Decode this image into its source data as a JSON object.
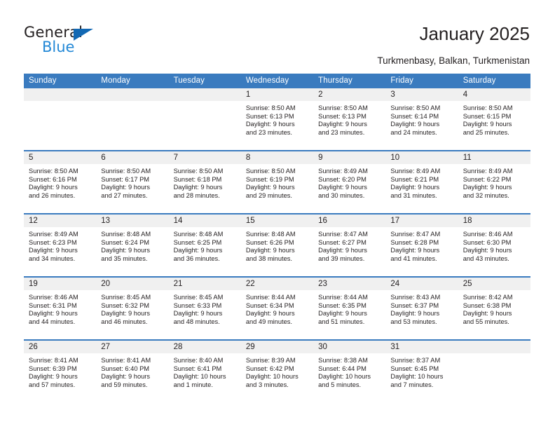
{
  "branding": {
    "logo_primary": "General",
    "logo_secondary": "Blue",
    "logo_icon": "triangle-flag-icon",
    "accent_color": "#3a7bbf",
    "logo_blue": "#2388d6"
  },
  "header": {
    "title": "January 2025",
    "subtitle": "Turkmenbasy, Balkan, Turkmenistan"
  },
  "calendar": {
    "weekday_headers": [
      "Sunday",
      "Monday",
      "Tuesday",
      "Wednesday",
      "Thursday",
      "Friday",
      "Saturday"
    ],
    "labels": {
      "sunrise": "Sunrise:",
      "sunset": "Sunset:",
      "daylight": "Daylight:"
    },
    "weeks": [
      [
        {
          "day": "",
          "empty": true
        },
        {
          "day": "",
          "empty": true
        },
        {
          "day": "",
          "empty": true
        },
        {
          "day": "1",
          "sunrise": "Sunrise: 8:50 AM",
          "sunset": "Sunset: 6:13 PM",
          "daylight1": "Daylight: 9 hours",
          "daylight2": "and 23 minutes."
        },
        {
          "day": "2",
          "sunrise": "Sunrise: 8:50 AM",
          "sunset": "Sunset: 6:13 PM",
          "daylight1": "Daylight: 9 hours",
          "daylight2": "and 23 minutes."
        },
        {
          "day": "3",
          "sunrise": "Sunrise: 8:50 AM",
          "sunset": "Sunset: 6:14 PM",
          "daylight1": "Daylight: 9 hours",
          "daylight2": "and 24 minutes."
        },
        {
          "day": "4",
          "sunrise": "Sunrise: 8:50 AM",
          "sunset": "Sunset: 6:15 PM",
          "daylight1": "Daylight: 9 hours",
          "daylight2": "and 25 minutes."
        }
      ],
      [
        {
          "day": "5",
          "sunrise": "Sunrise: 8:50 AM",
          "sunset": "Sunset: 6:16 PM",
          "daylight1": "Daylight: 9 hours",
          "daylight2": "and 26 minutes."
        },
        {
          "day": "6",
          "sunrise": "Sunrise: 8:50 AM",
          "sunset": "Sunset: 6:17 PM",
          "daylight1": "Daylight: 9 hours",
          "daylight2": "and 27 minutes."
        },
        {
          "day": "7",
          "sunrise": "Sunrise: 8:50 AM",
          "sunset": "Sunset: 6:18 PM",
          "daylight1": "Daylight: 9 hours",
          "daylight2": "and 28 minutes."
        },
        {
          "day": "8",
          "sunrise": "Sunrise: 8:50 AM",
          "sunset": "Sunset: 6:19 PM",
          "daylight1": "Daylight: 9 hours",
          "daylight2": "and 29 minutes."
        },
        {
          "day": "9",
          "sunrise": "Sunrise: 8:49 AM",
          "sunset": "Sunset: 6:20 PM",
          "daylight1": "Daylight: 9 hours",
          "daylight2": "and 30 minutes."
        },
        {
          "day": "10",
          "sunrise": "Sunrise: 8:49 AM",
          "sunset": "Sunset: 6:21 PM",
          "daylight1": "Daylight: 9 hours",
          "daylight2": "and 31 minutes."
        },
        {
          "day": "11",
          "sunrise": "Sunrise: 8:49 AM",
          "sunset": "Sunset: 6:22 PM",
          "daylight1": "Daylight: 9 hours",
          "daylight2": "and 32 minutes."
        }
      ],
      [
        {
          "day": "12",
          "sunrise": "Sunrise: 8:49 AM",
          "sunset": "Sunset: 6:23 PM",
          "daylight1": "Daylight: 9 hours",
          "daylight2": "and 34 minutes."
        },
        {
          "day": "13",
          "sunrise": "Sunrise: 8:48 AM",
          "sunset": "Sunset: 6:24 PM",
          "daylight1": "Daylight: 9 hours",
          "daylight2": "and 35 minutes."
        },
        {
          "day": "14",
          "sunrise": "Sunrise: 8:48 AM",
          "sunset": "Sunset: 6:25 PM",
          "daylight1": "Daylight: 9 hours",
          "daylight2": "and 36 minutes."
        },
        {
          "day": "15",
          "sunrise": "Sunrise: 8:48 AM",
          "sunset": "Sunset: 6:26 PM",
          "daylight1": "Daylight: 9 hours",
          "daylight2": "and 38 minutes."
        },
        {
          "day": "16",
          "sunrise": "Sunrise: 8:47 AM",
          "sunset": "Sunset: 6:27 PM",
          "daylight1": "Daylight: 9 hours",
          "daylight2": "and 39 minutes."
        },
        {
          "day": "17",
          "sunrise": "Sunrise: 8:47 AM",
          "sunset": "Sunset: 6:28 PM",
          "daylight1": "Daylight: 9 hours",
          "daylight2": "and 41 minutes."
        },
        {
          "day": "18",
          "sunrise": "Sunrise: 8:46 AM",
          "sunset": "Sunset: 6:30 PM",
          "daylight1": "Daylight: 9 hours",
          "daylight2": "and 43 minutes."
        }
      ],
      [
        {
          "day": "19",
          "sunrise": "Sunrise: 8:46 AM",
          "sunset": "Sunset: 6:31 PM",
          "daylight1": "Daylight: 9 hours",
          "daylight2": "and 44 minutes."
        },
        {
          "day": "20",
          "sunrise": "Sunrise: 8:45 AM",
          "sunset": "Sunset: 6:32 PM",
          "daylight1": "Daylight: 9 hours",
          "daylight2": "and 46 minutes."
        },
        {
          "day": "21",
          "sunrise": "Sunrise: 8:45 AM",
          "sunset": "Sunset: 6:33 PM",
          "daylight1": "Daylight: 9 hours",
          "daylight2": "and 48 minutes."
        },
        {
          "day": "22",
          "sunrise": "Sunrise: 8:44 AM",
          "sunset": "Sunset: 6:34 PM",
          "daylight1": "Daylight: 9 hours",
          "daylight2": "and 49 minutes."
        },
        {
          "day": "23",
          "sunrise": "Sunrise: 8:44 AM",
          "sunset": "Sunset: 6:35 PM",
          "daylight1": "Daylight: 9 hours",
          "daylight2": "and 51 minutes."
        },
        {
          "day": "24",
          "sunrise": "Sunrise: 8:43 AM",
          "sunset": "Sunset: 6:37 PM",
          "daylight1": "Daylight: 9 hours",
          "daylight2": "and 53 minutes."
        },
        {
          "day": "25",
          "sunrise": "Sunrise: 8:42 AM",
          "sunset": "Sunset: 6:38 PM",
          "daylight1": "Daylight: 9 hours",
          "daylight2": "and 55 minutes."
        }
      ],
      [
        {
          "day": "26",
          "sunrise": "Sunrise: 8:41 AM",
          "sunset": "Sunset: 6:39 PM",
          "daylight1": "Daylight: 9 hours",
          "daylight2": "and 57 minutes."
        },
        {
          "day": "27",
          "sunrise": "Sunrise: 8:41 AM",
          "sunset": "Sunset: 6:40 PM",
          "daylight1": "Daylight: 9 hours",
          "daylight2": "and 59 minutes."
        },
        {
          "day": "28",
          "sunrise": "Sunrise: 8:40 AM",
          "sunset": "Sunset: 6:41 PM",
          "daylight1": "Daylight: 10 hours",
          "daylight2": "and 1 minute."
        },
        {
          "day": "29",
          "sunrise": "Sunrise: 8:39 AM",
          "sunset": "Sunset: 6:42 PM",
          "daylight1": "Daylight: 10 hours",
          "daylight2": "and 3 minutes."
        },
        {
          "day": "30",
          "sunrise": "Sunrise: 8:38 AM",
          "sunset": "Sunset: 6:44 PM",
          "daylight1": "Daylight: 10 hours",
          "daylight2": "and 5 minutes."
        },
        {
          "day": "31",
          "sunrise": "Sunrise: 8:37 AM",
          "sunset": "Sunset: 6:45 PM",
          "daylight1": "Daylight: 10 hours",
          "daylight2": "and 7 minutes."
        },
        {
          "day": "",
          "empty": true
        }
      ]
    ]
  }
}
